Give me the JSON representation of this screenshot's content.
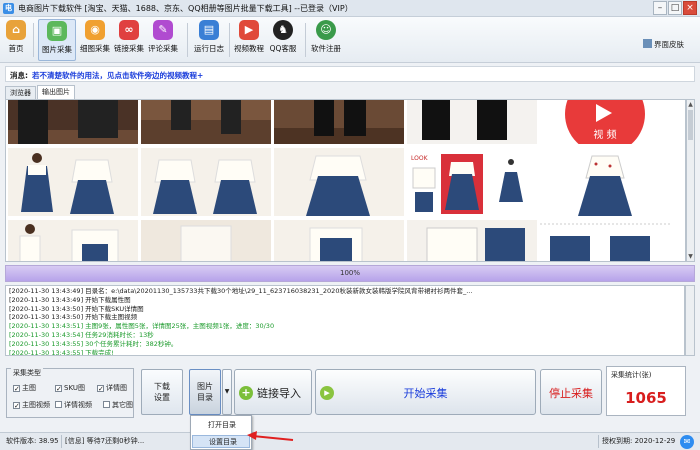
{
  "window": {
    "title": "电商图片下载软件 [淘宝、天猫、1688、京东、QQ相册等图片批量下载工具] --已登录（VIP）",
    "controls": {
      "minimize": "–",
      "maximize": "□",
      "close": "×"
    }
  },
  "toolbar": {
    "items": [
      {
        "label": "首页",
        "icon": "home-icon",
        "color": "#e8a23a"
      },
      {
        "label": "图片采集",
        "icon": "image-collect-icon",
        "color": "#5cb85c"
      },
      {
        "label": "细图采集",
        "icon": "detail-image-icon",
        "color": "#f0a030"
      },
      {
        "label": "链接采集",
        "icon": "link-icon",
        "color": "#e04040"
      },
      {
        "label": "评论采集",
        "icon": "comment-icon",
        "color": "#b04bd0"
      },
      {
        "label": "运行日志",
        "icon": "log-icon",
        "color": "#3a7fd5"
      },
      {
        "label": "视频教程",
        "icon": "video-icon",
        "color": "#e04a3a"
      },
      {
        "label": "QQ客服",
        "icon": "qq-icon",
        "color": "#222222"
      },
      {
        "label": "软件注册",
        "icon": "user-register-icon",
        "color": "#3a9a4a"
      }
    ],
    "skin_label": "界面皮肤"
  },
  "message": {
    "key": "消息:",
    "text": "若不清楚软件的用法，见点击软件旁边的视频教程+"
  },
  "tabs": [
    {
      "label": "浏览器",
      "selected": false
    },
    {
      "label": "输出图片",
      "selected": true
    }
  ],
  "gallery": {
    "video_label": "视 频",
    "look_label": "LOOK"
  },
  "progress": {
    "value": 100,
    "label": "100%"
  },
  "log": [
    {
      "text": "[2020-11-30 13:43:49] 目录名：e:\\data\\20201130_135733共下载30个地址\\29_11_623716038231_2020秋装新款女装韩版学院风背带裙衬衫两件套_...",
      "color": "normal"
    },
    {
      "text": "[2020-11-30 13:43:49] 开始下载属性图",
      "color": "normal"
    },
    {
      "text": "[2020-11-30 13:43:50] 开始下载SKU详情图",
      "color": "normal"
    },
    {
      "text": "[2020-11-30 13:43:50] 开始下载主图视频",
      "color": "normal"
    },
    {
      "text": "[2020-11-30 13:43:51] 主图9张，属性图5张，详情图25张，主图视频1张，进度：30/30",
      "color": "green"
    },
    {
      "text": "[2020-11-30 13:43:54] 任务29消耗时长：13秒",
      "color": "green"
    },
    {
      "text": "[2020-11-30 13:43:55] 30个任务累计耗时：382秒钟。",
      "color": "green"
    },
    {
      "text": "[2020-11-30 13:43:55] 下载完成!",
      "color": "green"
    }
  ],
  "collect_type": {
    "title": "采集类型",
    "options": [
      {
        "label": "主图",
        "checked": true
      },
      {
        "label": "SKU图",
        "checked": true
      },
      {
        "label": "详情图",
        "checked": true
      },
      {
        "label": "主图视频",
        "checked": true
      },
      {
        "label": "详情视频",
        "checked": false
      },
      {
        "label": "其它图",
        "checked": false
      }
    ]
  },
  "buttons": {
    "download_settings": "下载\n设置",
    "image_dir": "图片\n目录",
    "link_import": "链接导入",
    "start": "开始采集",
    "stop": "停止采集"
  },
  "stats": {
    "title": "采集统计(张)",
    "count": "1065"
  },
  "dropdown_menu": {
    "items": [
      "打开目录",
      "设置目录"
    ],
    "highlighted": 1
  },
  "statusbar": {
    "version": "软件版本: 38.95",
    "info": "[信息] 等待7还剩0秒钟...",
    "expire": "授权到期: 2020-12-29"
  },
  "colors": {
    "start_text": "#1a3ddb",
    "stop_text": "#d81e1e",
    "count_text": "#d81e1e",
    "log_green": "#1c9b2c",
    "progress_fill": "#b7a3ea"
  }
}
